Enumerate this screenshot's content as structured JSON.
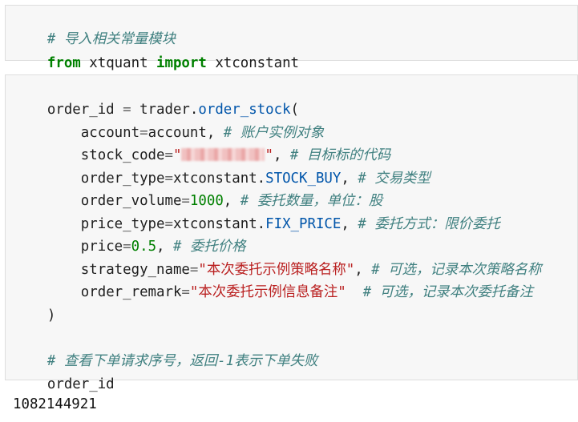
{
  "cell1": {
    "comment": "# 导入相关常量模块",
    "kw_from": "from",
    "module": " xtquant ",
    "kw_import": "import",
    "name": " xtconstant"
  },
  "cell2": {
    "line1": {
      "var": "order_id ",
      "eq": "=",
      "obj": " trader.",
      "func": "order_stock",
      "paren": "("
    },
    "line2": {
      "indent": "    ",
      "key": "account",
      "eq": "=",
      "val": "account,",
      "comment": " # 账户实例对象"
    },
    "line3": {
      "indent": "    ",
      "key": "stock_code",
      "eq": "=",
      "q1": "\"",
      "q2": "\"",
      "tail": ",",
      "comment": " # 目标标的代码"
    },
    "line4": {
      "indent": "    ",
      "key": "order_type",
      "eq": "=",
      "obj": "xtconstant.",
      "attr": "STOCK_BUY",
      "tail": ",",
      "comment": " # 交易类型"
    },
    "line5": {
      "indent": "    ",
      "key": "order_volume",
      "eq": "=",
      "num": "1000",
      "tail": ",",
      "comment": " # 委托数量，单位：股"
    },
    "line6": {
      "indent": "    ",
      "key": "price_type",
      "eq": "=",
      "obj": "xtconstant.",
      "attr": "FIX_PRICE",
      "tail": ",",
      "comment": " # 委托方式：限价委托"
    },
    "line7": {
      "indent": "    ",
      "key": "price",
      "eq": "=",
      "num": "0.5",
      "tail": ",",
      "comment": " # 委托价格"
    },
    "line8": {
      "indent": "    ",
      "key": "strategy_name",
      "eq": "=",
      "str": "\"本次委托示例策略名称\"",
      "tail": ",",
      "comment": " # 可选，记录本次策略名称"
    },
    "line9": {
      "indent": "    ",
      "key": "order_remark",
      "eq": "=",
      "str": "\"本次委托示例信息备注\"",
      "tail": "  ",
      "comment": "# 可选，记录本次委托备注"
    },
    "line10": {
      "paren": ")"
    },
    "line12": {
      "comment": "# 查看下单请求序号，返回-1表示下单失败"
    },
    "line13": {
      "var": "order_id"
    }
  },
  "output": {
    "value": "1082144921"
  }
}
